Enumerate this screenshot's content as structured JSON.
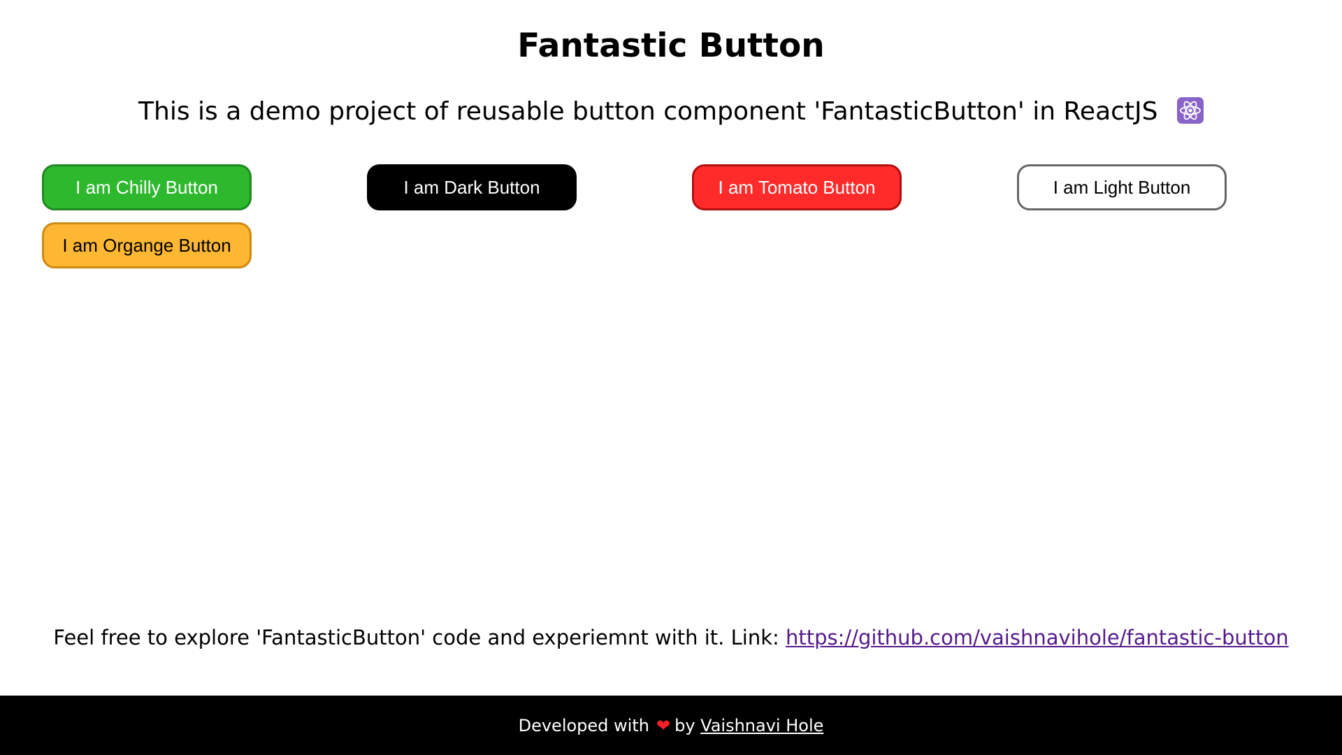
{
  "page": {
    "title": "Fantastic Button",
    "subtitle": "This is a demo project of reusable button component 'FantasticButton' in ReactJS",
    "subtitle_icon": "react-icon"
  },
  "buttons": [
    {
      "label": "I am Chilly Button",
      "bg": "#2eb82e",
      "border": "#1f8a1f",
      "color": "#ffffff"
    },
    {
      "label": "I am Dark Button",
      "bg": "#000000",
      "border": "#000000",
      "color": "#ffffff"
    },
    {
      "label": "I am Tomato Button",
      "bg": "#ff2b2b",
      "border": "#b30f0f",
      "color": "#ffffff"
    },
    {
      "label": "I am Light Button",
      "bg": "#ffffff",
      "border": "#666666",
      "color": "#000000"
    },
    {
      "label": "I am Organge Button",
      "bg": "#fdb732",
      "border": "#cf8a12",
      "color": "#000000"
    }
  ],
  "note": {
    "text": "Feel free to explore 'FantasticButton' code and experiemnt with it. Link:",
    "link_text": "https://github.com/vaishnavihole/fantastic-button"
  },
  "footer": {
    "prefix": "Developed with",
    "heart_icon": "heart-icon",
    "by": "by",
    "author": "Vaishnavi Hole"
  }
}
